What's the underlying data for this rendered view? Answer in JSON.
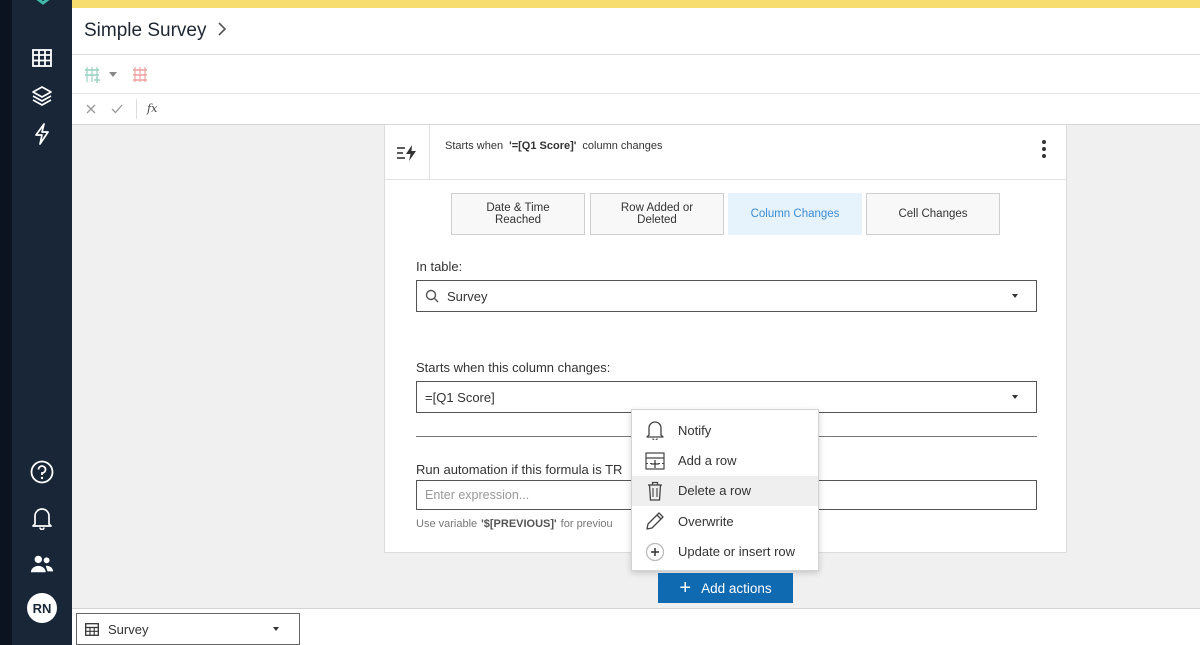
{
  "header": {
    "title": "Simple Survey"
  },
  "sidebar": {
    "items": [
      {
        "icon": "table-grid-icon"
      },
      {
        "icon": "layers-icon"
      },
      {
        "icon": "lightning-icon"
      }
    ],
    "bottom": [
      {
        "icon": "help-icon"
      },
      {
        "icon": "bell-icon"
      },
      {
        "icon": "users-icon"
      }
    ],
    "avatar": "RN"
  },
  "formula_bar": {
    "fx": "fx"
  },
  "automation": {
    "trigger": {
      "prefix": "Starts when",
      "column": "'=[Q1 Score]'",
      "suffix": "column changes"
    },
    "tabs": [
      {
        "label": "Date & Time Reached",
        "line1": "Date & Time",
        "line2": "Reached",
        "active": false
      },
      {
        "label": "Row Added or Deleted",
        "line1": "Row Added or",
        "line2": "Deleted",
        "active": false
      },
      {
        "label": "Column Changes",
        "line1": "Column Changes",
        "line2": "",
        "active": true
      },
      {
        "label": "Cell Changes",
        "line1": "Cell Changes",
        "line2": "",
        "active": false
      }
    ],
    "in_table": {
      "label": "In table:",
      "value": "Survey"
    },
    "column_changes": {
      "label": "Starts when this column changes:",
      "value": "=[Q1 Score]"
    },
    "condition": {
      "label": "Run automation if this formula is TR",
      "placeholder": "Enter expression...",
      "hint_prefix": "Use variable",
      "hint_var": "'$[PREVIOUS]'",
      "hint_suffix": "for previou"
    }
  },
  "actions_menu": {
    "items": [
      {
        "label": "Notify",
        "icon": "bell-icon"
      },
      {
        "label": "Add a row",
        "icon": "add-row-icon"
      },
      {
        "label": "Delete a row",
        "icon": "trash-icon"
      },
      {
        "label": "Overwrite",
        "icon": "pencil-icon"
      },
      {
        "label": "Update or insert row",
        "icon": "plus-circle-icon"
      }
    ],
    "hovered_index": 2
  },
  "add_actions": {
    "label": "Add actions"
  },
  "bottom_bar": {
    "table_value": "Survey"
  },
  "colors": {
    "sidebar": "#182638",
    "top_stripe": "#f7dc6f",
    "primary_button": "#106ab2",
    "active_tab_bg": "#e6f2fc",
    "active_tab_text": "#3b8dd6",
    "logo_teal": "#3fb8a8"
  }
}
